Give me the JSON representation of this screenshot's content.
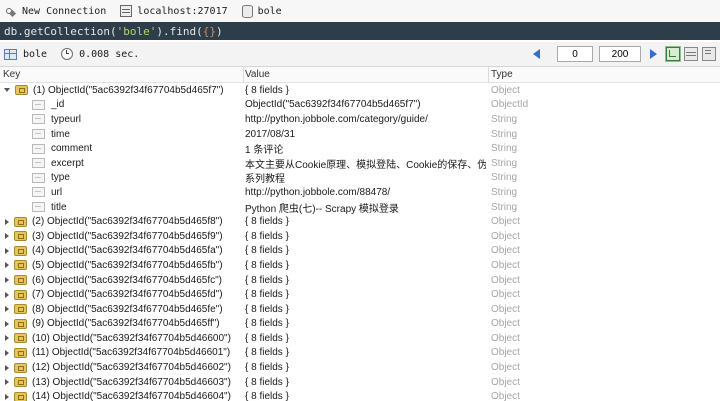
{
  "connection": {
    "name": "New Connection",
    "server": "localhost:27017",
    "database": "bole"
  },
  "query": {
    "prefix": "db.getCollection(",
    "collection_string": "'bole'",
    "middle": ").find(",
    "filter": "{}",
    "suffix": ")"
  },
  "toolbar": {
    "collection": "bole",
    "elapsed": "0.008 sec.",
    "skip": "0",
    "limit": "200"
  },
  "columns": {
    "key": "Key",
    "value": "Value",
    "type": "Type"
  },
  "rows": [
    {
      "expander": "open",
      "icon": "object-icon",
      "key": "(1) ObjectId(\"5ac6392f34f67704b5d465f7\")",
      "value": "{ 8 fields }",
      "type": "Object"
    },
    {
      "expander": "none",
      "icon": "field-icon",
      "key": "_id",
      "value": "ObjectId(\"5ac6392f34f67704b5d465f7\")",
      "type": "ObjectId"
    },
    {
      "expander": "none",
      "icon": "field-icon",
      "key": "typeurl",
      "value": "http://python.jobbole.com/category/guide/",
      "type": "String"
    },
    {
      "expander": "none",
      "icon": "field-icon",
      "key": "time",
      "value": "2017/08/31",
      "type": "String"
    },
    {
      "expander": "none",
      "icon": "field-icon",
      "key": "comment",
      "value": "1 条评论",
      "type": "String"
    },
    {
      "expander": "none",
      "icon": "field-icon",
      "key": "excerpt",
      "value": "本文主要从Cookie原理、模拟登陆、Cookie的保存、伪...",
      "type": "String"
    },
    {
      "expander": "none",
      "icon": "field-icon",
      "key": "type",
      "value": "系列教程",
      "type": "String"
    },
    {
      "expander": "none",
      "icon": "field-icon",
      "key": "url",
      "value": "http://python.jobbole.com/88478/",
      "type": "String"
    },
    {
      "expander": "none",
      "icon": "field-icon",
      "key": "title",
      "value": "Python 爬虫(七)-- Scrapy 模拟登录",
      "type": "String"
    },
    {
      "expander": "closed",
      "icon": "object-icon",
      "key": "(2) ObjectId(\"5ac6392f34f67704b5d465f8\")",
      "value": "{ 8 fields }",
      "type": "Object"
    },
    {
      "expander": "closed",
      "icon": "object-icon",
      "key": "(3) ObjectId(\"5ac6392f34f67704b5d465f9\")",
      "value": "{ 8 fields }",
      "type": "Object"
    },
    {
      "expander": "closed",
      "icon": "object-icon",
      "key": "(4) ObjectId(\"5ac6392f34f67704b5d465fa\")",
      "value": "{ 8 fields }",
      "type": "Object"
    },
    {
      "expander": "closed",
      "icon": "object-icon",
      "key": "(5) ObjectId(\"5ac6392f34f67704b5d465fb\")",
      "value": "{ 8 fields }",
      "type": "Object"
    },
    {
      "expander": "closed",
      "icon": "object-icon",
      "key": "(6) ObjectId(\"5ac6392f34f67704b5d465fc\")",
      "value": "{ 8 fields }",
      "type": "Object"
    },
    {
      "expander": "closed",
      "icon": "object-icon",
      "key": "(7) ObjectId(\"5ac6392f34f67704b5d465fd\")",
      "value": "{ 8 fields }",
      "type": "Object"
    },
    {
      "expander": "closed",
      "icon": "object-icon",
      "key": "(8) ObjectId(\"5ac6392f34f67704b5d465fe\")",
      "value": "{ 8 fields }",
      "type": "Object"
    },
    {
      "expander": "closed",
      "icon": "object-icon",
      "key": "(9) ObjectId(\"5ac6392f34f67704b5d465ff\")",
      "value": "{ 8 fields }",
      "type": "Object"
    },
    {
      "expander": "closed",
      "icon": "object-icon",
      "key": "(10) ObjectId(\"5ac6392f34f67704b5d46600\")",
      "value": "{ 8 fields }",
      "type": "Object"
    },
    {
      "expander": "closed",
      "icon": "object-icon",
      "key": "(11) ObjectId(\"5ac6392f34f67704b5d46601\")",
      "value": "{ 8 fields }",
      "type": "Object"
    },
    {
      "expander": "closed",
      "icon": "object-icon",
      "key": "(12) ObjectId(\"5ac6392f34f67704b5d46602\")",
      "value": "{ 8 fields }",
      "type": "Object"
    },
    {
      "expander": "closed",
      "icon": "object-icon",
      "key": "(13) ObjectId(\"5ac6392f34f67704b5d46603\")",
      "value": "{ 8 fields }",
      "type": "Object"
    },
    {
      "expander": "closed",
      "icon": "object-icon",
      "key": "(14) ObjectId(\"5ac6392f34f67704b5d46604\")",
      "value": "{ 8 fields }",
      "type": "Object"
    }
  ],
  "colors": {
    "query_bar_bg": "#2d3e4a",
    "query_string": "#b5d46a",
    "type_text": "#a5a5a5",
    "pager_arrow": "#2f6fcf"
  }
}
